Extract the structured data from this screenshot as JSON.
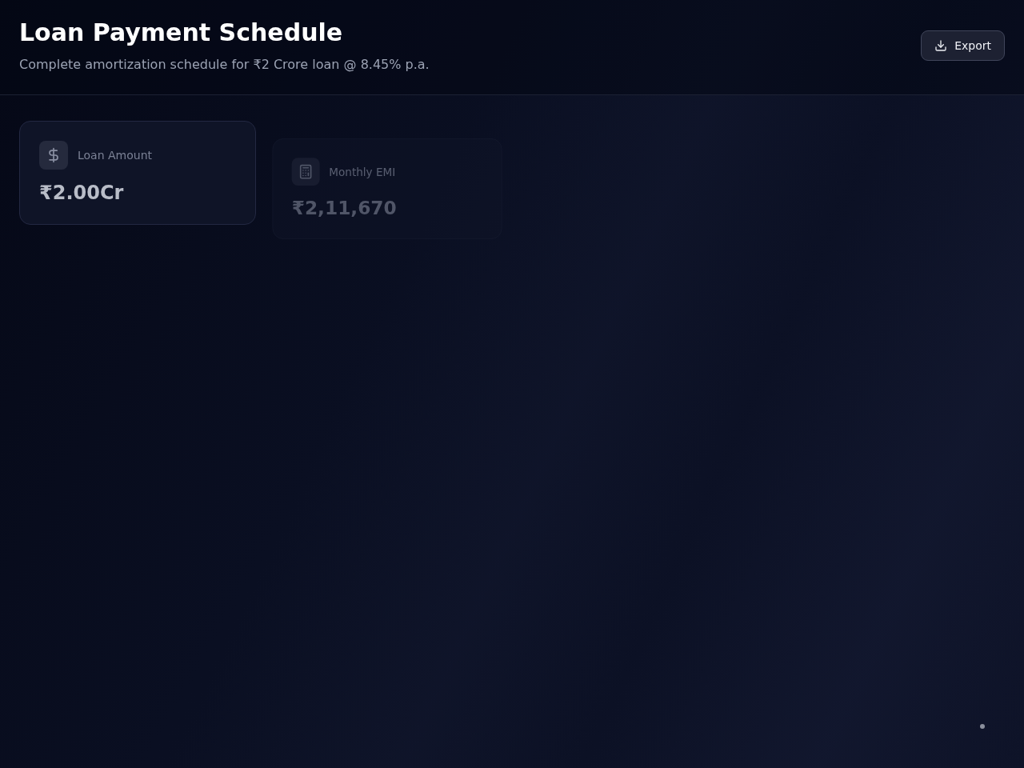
{
  "header": {
    "title": "Loan Payment Schedule",
    "subtitle": "Complete amortization schedule for ₹2 Crore loan @ 8.45% p.a.",
    "export_button": "Export"
  },
  "stat_cards": [
    {
      "kind": "amount",
      "label": "Loan Amount",
      "value": "₹2.00Cr",
      "dimmed": false
    },
    {
      "kind": "emi",
      "label": "Monthly EMI",
      "value": "₹2,11,670",
      "dimmed": true
    }
  ]
}
